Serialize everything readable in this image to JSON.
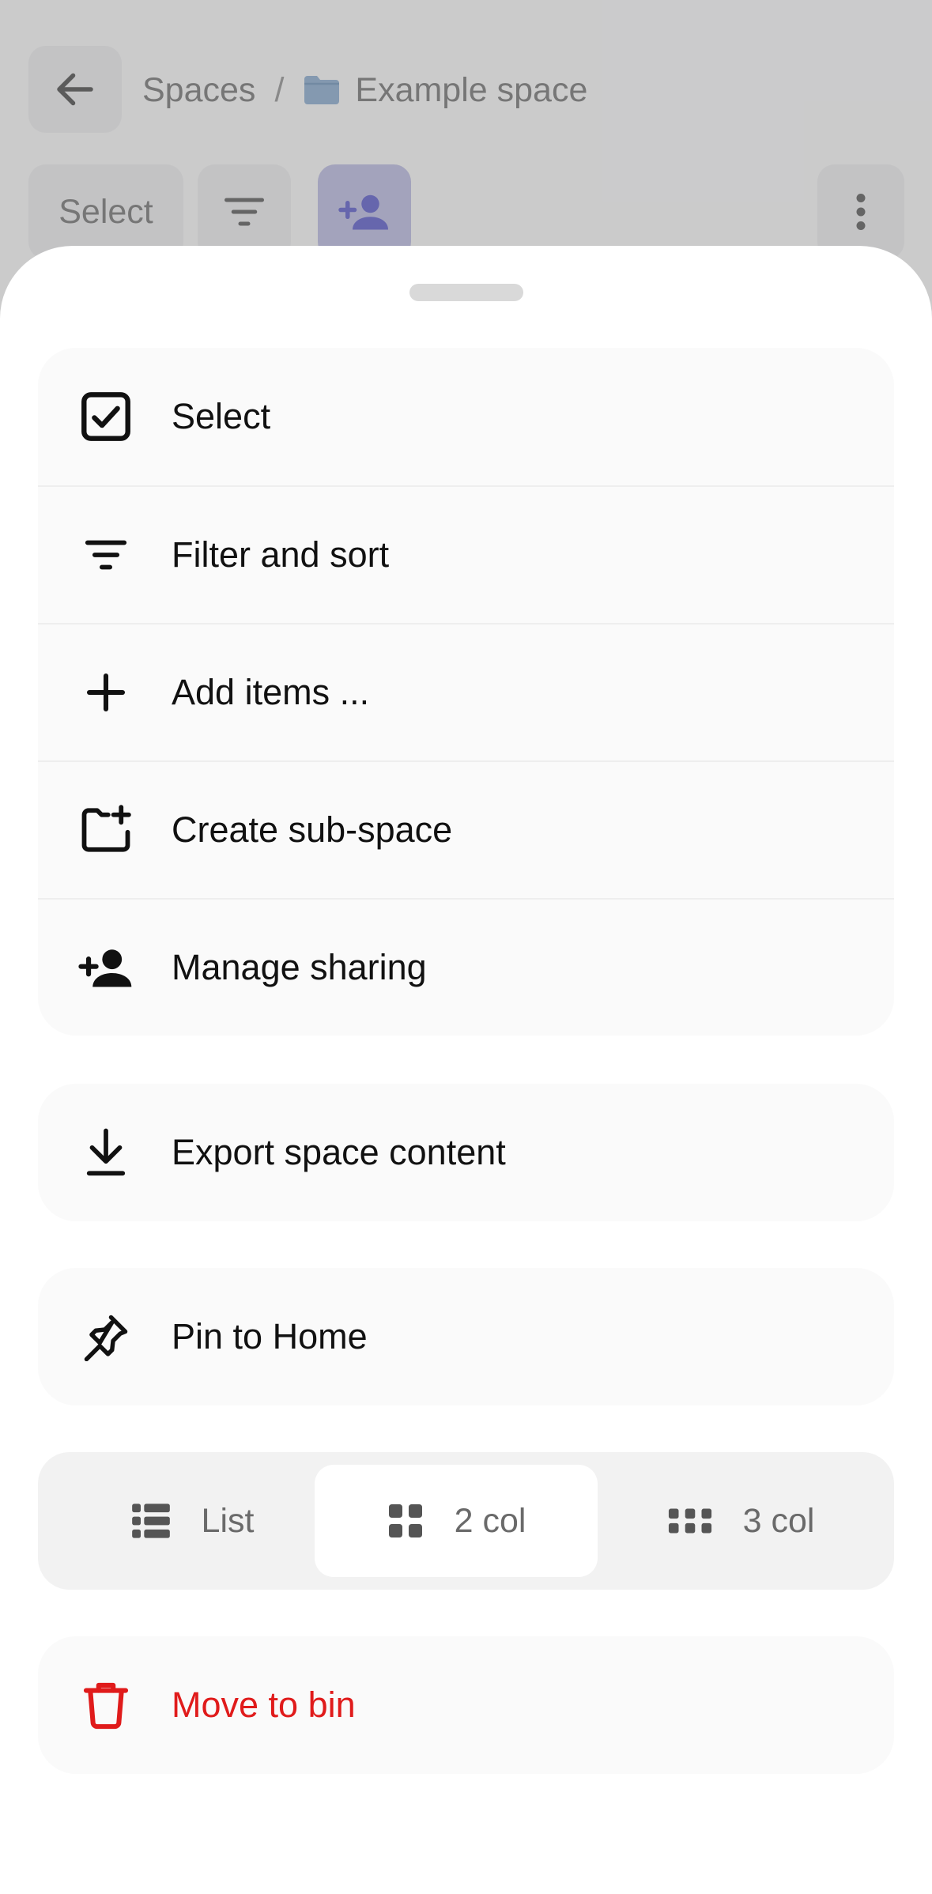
{
  "background": {
    "breadcrumb": {
      "root": "Spaces",
      "separator": "/",
      "current": "Example space"
    },
    "toolbar": {
      "select_label": "Select"
    },
    "icons": {
      "back": "arrow-left-icon",
      "folder": "folder-icon",
      "filter": "filter-icon",
      "share": "person-add-icon",
      "more": "more-vertical-icon"
    },
    "colors": {
      "folder": "#9fb9d4",
      "share_accent": "#7b7bd0"
    }
  },
  "sheet": {
    "groups": [
      {
        "items": [
          {
            "label": "Select",
            "icon": "checkbox-icon"
          },
          {
            "label": "Filter and sort",
            "icon": "filter-icon"
          },
          {
            "label": "Add items ...",
            "icon": "plus-icon"
          },
          {
            "label": "Create sub-space",
            "icon": "folder-add-icon"
          },
          {
            "label": "Manage sharing",
            "icon": "person-add-icon"
          }
        ]
      },
      {
        "items": [
          {
            "label": "Export space content",
            "icon": "download-icon"
          }
        ]
      },
      {
        "items": [
          {
            "label": "Pin to Home",
            "icon": "pin-icon"
          }
        ]
      }
    ],
    "view_switcher": {
      "options": [
        {
          "label": "List",
          "icon": "list-icon"
        },
        {
          "label": "2 col",
          "icon": "grid-2-icon"
        },
        {
          "label": "3 col",
          "icon": "grid-3-icon"
        }
      ],
      "selected": "2 col"
    },
    "danger": {
      "label": "Move to bin",
      "icon": "trash-icon",
      "color": "#e01b1b"
    }
  }
}
